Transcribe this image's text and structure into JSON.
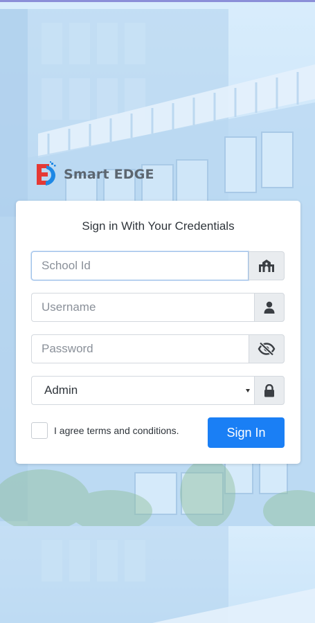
{
  "brand": {
    "name": "Smart EDGE",
    "logo_letter": "E"
  },
  "card": {
    "title": "Sign in With Your Credentials"
  },
  "fields": {
    "school_id": {
      "placeholder": "School Id",
      "icon": "school-building-icon"
    },
    "username": {
      "placeholder": "Username",
      "icon": "user-icon"
    },
    "password": {
      "placeholder": "Password",
      "icon": "eye-slash-icon"
    },
    "role": {
      "selected": "Admin",
      "icon": "lock-icon"
    }
  },
  "agree": {
    "label": "I agree terms and conditions."
  },
  "buttons": {
    "sign_in": "Sign In"
  },
  "colors": {
    "primary": "#1a7ff5",
    "addon_bg": "#e9ecef",
    "background": "#c6e1f7",
    "logo_red": "#e53935",
    "logo_blue": "#1e88e5"
  }
}
